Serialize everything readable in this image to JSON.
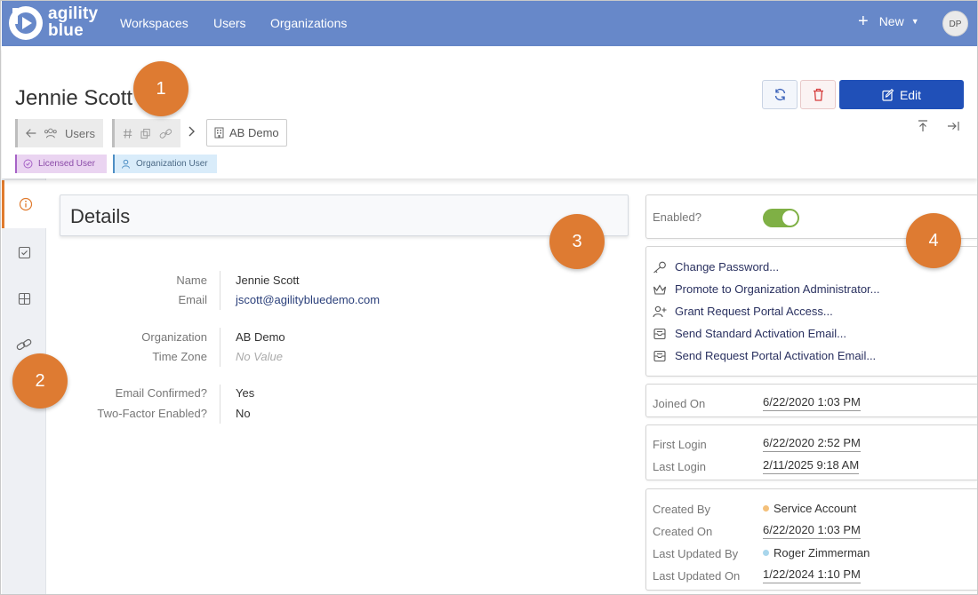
{
  "nav": {
    "logo_top": "agility",
    "logo_bottom": "blue",
    "links": [
      "Workspaces",
      "Users",
      "Organizations"
    ],
    "new_label": "New",
    "avatar_initials": "DP"
  },
  "header": {
    "title": "Jennie Scott",
    "crumb_users": "Users",
    "crumb_org": "AB Demo",
    "badges": {
      "licensed": "Licensed User",
      "org_user": "Organization User"
    },
    "edit_label": "Edit"
  },
  "details": {
    "title": "Details",
    "fields": {
      "name": {
        "label": "Name",
        "value": "Jennie Scott"
      },
      "email": {
        "label": "Email",
        "value": "jscott@agilitybluedemo.com"
      },
      "organization": {
        "label": "Organization",
        "value": "AB Demo"
      },
      "time_zone": {
        "label": "Time Zone",
        "value": "No Value"
      },
      "email_confirmed": {
        "label": "Email Confirmed?",
        "value": "Yes"
      },
      "two_factor": {
        "label": "Two-Factor Enabled?",
        "value": "No"
      }
    }
  },
  "side": {
    "enabled_label": "Enabled?",
    "enabled": true,
    "actions": {
      "change_password": "Change Password...",
      "promote": "Promote to Organization Administrator...",
      "grant_portal": "Grant Request Portal Access...",
      "send_standard": "Send Standard Activation Email...",
      "send_portal": "Send Request Portal Activation Email..."
    },
    "joined": {
      "label": "Joined On",
      "value": "6/22/2020 1:03 PM"
    },
    "first_login": {
      "label": "First Login",
      "value": "6/22/2020 2:52 PM"
    },
    "last_login": {
      "label": "Last Login",
      "value": "2/11/2025 9:18 AM"
    },
    "created_by": {
      "label": "Created By",
      "value": "Service Account"
    },
    "created_on": {
      "label": "Created On",
      "value": "6/22/2020 1:03 PM"
    },
    "updated_by": {
      "label": "Last Updated By",
      "value": "Roger Zimmerman"
    },
    "updated_on": {
      "label": "Last Updated On",
      "value": "1/22/2024 1:10 PM"
    }
  },
  "callouts": [
    "1",
    "2",
    "3",
    "4"
  ],
  "colors": {
    "nav_bg": "#6788c9",
    "primary_button": "#2050b8",
    "callout": "#de7b32",
    "toggle_on": "#7fb045",
    "active_tab_accent": "#e07b2e"
  }
}
